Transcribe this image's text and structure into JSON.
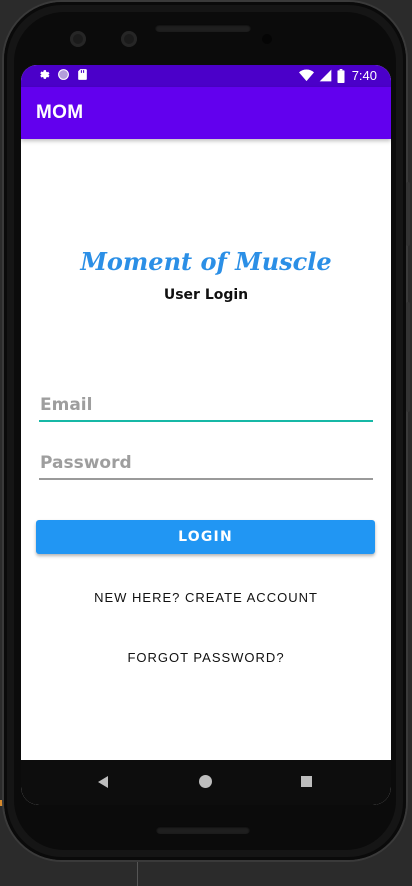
{
  "status_bar": {
    "time": "7:40",
    "left_icons": [
      "gear-icon",
      "circle-icon",
      "sd-card-icon"
    ],
    "right_icons": [
      "wifi-icon",
      "signal-icon",
      "battery-icon"
    ],
    "color": "#4b00c9"
  },
  "app_bar": {
    "title": "MOM",
    "color": "#6200ee"
  },
  "login": {
    "brand": "Moment of Muscle",
    "subtitle": "User Login",
    "email_placeholder": "Email",
    "password_placeholder": "Password",
    "login_label": "LOGIN",
    "create_account_label": "NEW HERE? CREATE ACCOUNT",
    "forgot_password_label": "FORGOT PASSWORD?",
    "accent_color": "#2196f3",
    "brand_color": "#2b8fe6"
  },
  "nav_bar": {
    "icons": [
      "back-icon",
      "home-icon",
      "recents-icon"
    ]
  }
}
